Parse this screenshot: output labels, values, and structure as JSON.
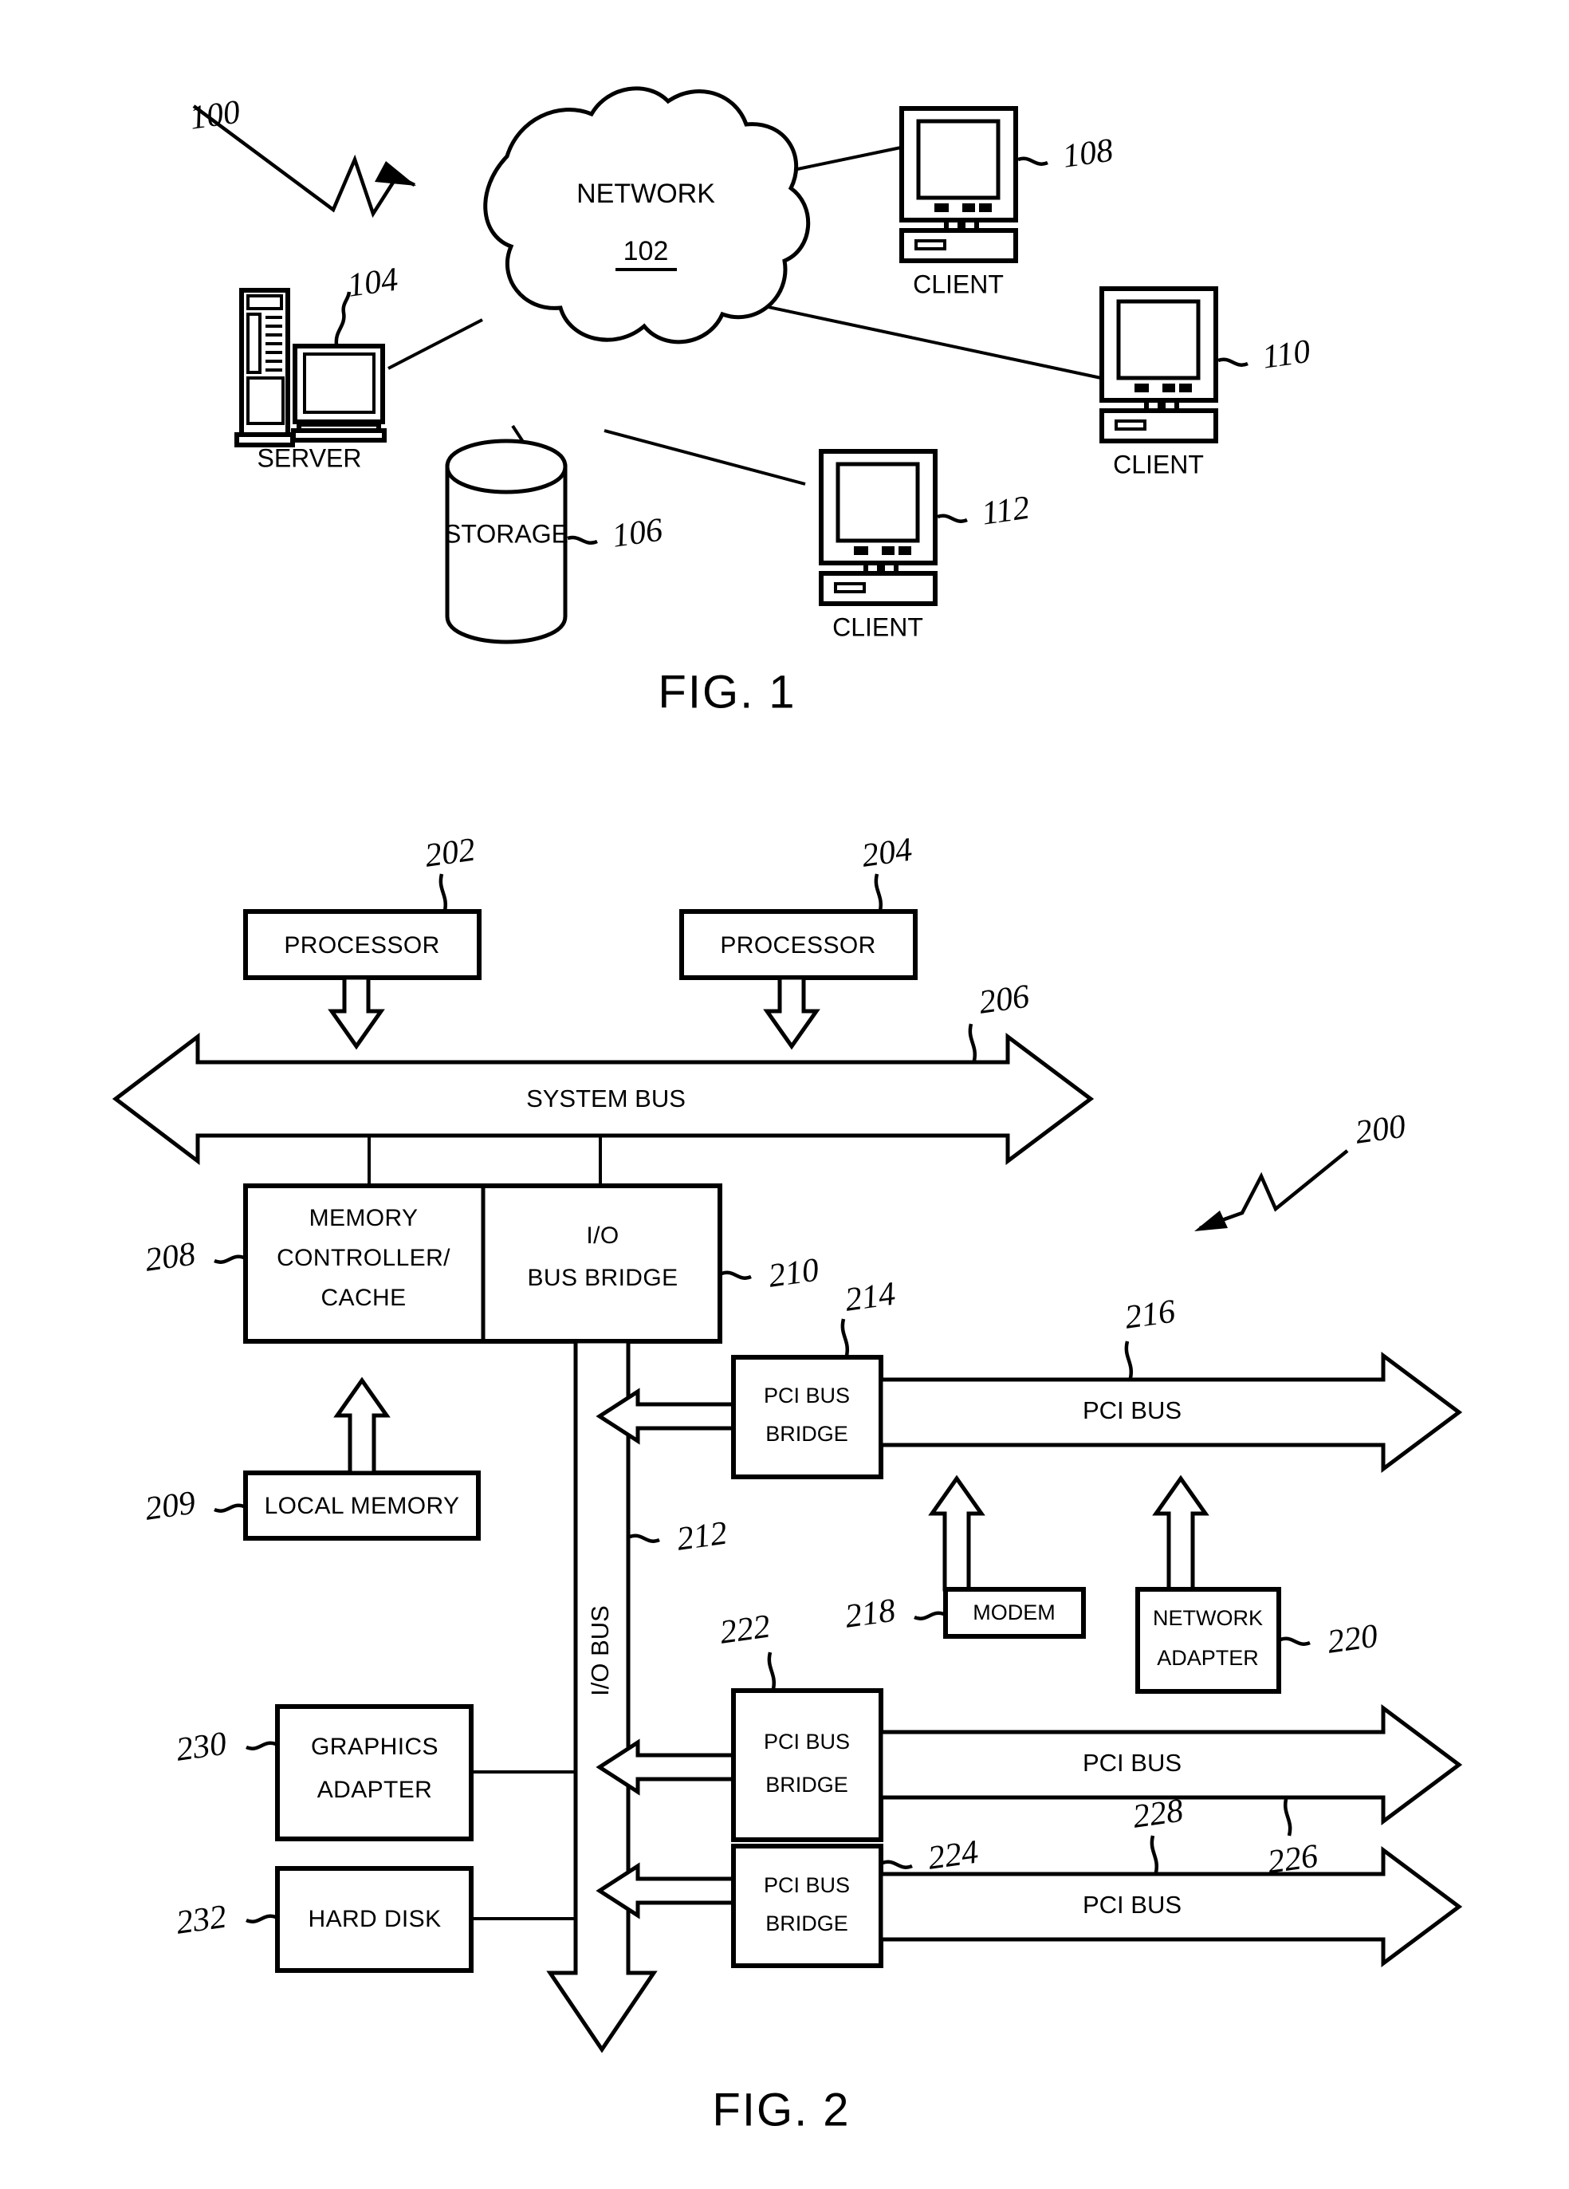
{
  "figure1": {
    "caption": "FIG. 1",
    "ref": "100",
    "cloud": {
      "label": "NETWORK",
      "ref": "102"
    },
    "nodes": [
      {
        "name": "server",
        "label": "SERVER",
        "ref": "104"
      },
      {
        "name": "storage",
        "label": "STORAGE",
        "ref": "106"
      },
      {
        "name": "client-1",
        "label": "CLIENT",
        "ref": "108"
      },
      {
        "name": "client-2",
        "label": "CLIENT",
        "ref": "110"
      },
      {
        "name": "client-3",
        "label": "CLIENT",
        "ref": "112"
      }
    ]
  },
  "figure2": {
    "caption": "FIG. 2",
    "ref": "200",
    "blocks": [
      {
        "name": "processor-1",
        "label": "PROCESSOR",
        "ref": "202"
      },
      {
        "name": "processor-2",
        "label": "PROCESSOR",
        "ref": "204"
      },
      {
        "name": "system-bus",
        "label": "SYSTEM BUS",
        "ref": "206"
      },
      {
        "name": "memory-controller",
        "label": "MEMORY CONTROLLER/ CACHE",
        "ref": "208"
      },
      {
        "name": "local-memory",
        "label": "LOCAL MEMORY",
        "ref": "209"
      },
      {
        "name": "io-bus-bridge",
        "label": "I/O BUS BRIDGE",
        "ref": "210"
      },
      {
        "name": "io-bus",
        "label": "I/O BUS",
        "ref": "212"
      },
      {
        "name": "pci-bus-bridge-1",
        "label": "PCI BUS BRIDGE",
        "ref": "214"
      },
      {
        "name": "pci-bus-1",
        "label": "PCI BUS",
        "ref": "216"
      },
      {
        "name": "modem",
        "label": "MODEM",
        "ref": "218"
      },
      {
        "name": "network-adapter",
        "label": "NETWORK ADAPTER",
        "ref": "220"
      },
      {
        "name": "pci-bus-bridge-2",
        "label": "PCI BUS BRIDGE",
        "ref": "222"
      },
      {
        "name": "pci-bus-2",
        "label": "PCI BUS",
        "ref": "226"
      },
      {
        "name": "pci-bus-bridge-3",
        "label": "PCI BUS BRIDGE",
        "ref": "224"
      },
      {
        "name": "pci-bus-3",
        "label": "PCI BUS",
        "ref": "228"
      },
      {
        "name": "graphics-adapter",
        "label": "GRAPHICS ADAPTER",
        "ref": "230"
      },
      {
        "name": "hard-disk",
        "label": "HARD DISK",
        "ref": "232"
      }
    ],
    "text": {
      "processor_1": "PROCESSOR",
      "processor_2": "PROCESSOR",
      "system_bus": "SYSTEM BUS",
      "mem_ctrl_l1": "MEMORY",
      "mem_ctrl_l2": "CONTROLLER/",
      "mem_ctrl_l3": "CACHE",
      "io_bridge_l1": "I/O",
      "io_bridge_l2": "BUS BRIDGE",
      "local_memory": "LOCAL MEMORY",
      "io_bus": "I/O BUS",
      "pci_bridge_l1": "PCI BUS",
      "pci_bridge_l2": "BRIDGE",
      "pci_bus": "PCI BUS",
      "modem": "MODEM",
      "net_adapter_l1": "NETWORK",
      "net_adapter_l2": "ADAPTER",
      "graphics_l1": "GRAPHICS",
      "graphics_l2": "ADAPTER",
      "hard_disk": "HARD DISK"
    },
    "refs": {
      "r200": "200",
      "r202": "202",
      "r204": "204",
      "r206": "206",
      "r208": "208",
      "r209": "209",
      "r210": "210",
      "r212": "212",
      "r214": "214",
      "r216": "216",
      "r218": "218",
      "r220": "220",
      "r222": "222",
      "r224": "224",
      "r226": "226",
      "r228": "228",
      "r230": "230",
      "r232": "232"
    }
  },
  "colors": {
    "ink": "#000000",
    "paper": "#ffffff"
  }
}
